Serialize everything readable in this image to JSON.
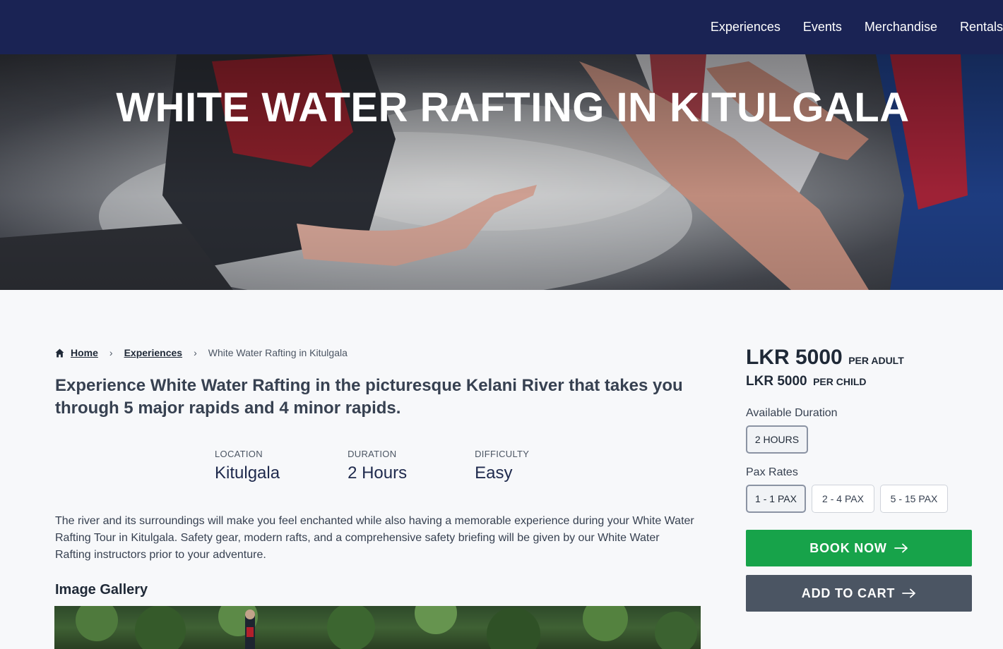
{
  "nav": {
    "items": [
      "Experiences",
      "Events",
      "Merchandise",
      "Rentals"
    ]
  },
  "hero": {
    "title": "WHITE WATER RAFTING IN KITULGALA"
  },
  "breadcrumb": {
    "home": "Home",
    "experiences": "Experiences",
    "current": "White Water Rafting in Kitulgala",
    "home_icon": "home-icon",
    "separator": "›"
  },
  "intro": {
    "lead": "Experience White Water Rafting in the picturesque Kelani River that takes you through 5 major rapids and 4 minor rapids.",
    "facts": [
      {
        "label": "LOCATION",
        "value": "Kitulgala"
      },
      {
        "label": "DURATION",
        "value": "2 Hours"
      },
      {
        "label": "DIFFICULTY",
        "value": "Easy"
      }
    ],
    "description": "The river and its surroundings will make you feel enchanted while also having a memorable experience during your White Water Rafting Tour in Kitulgala. Safety gear, modern rafts, and a comprehensive safety briefing will be given by our White Water Rafting instructors prior to your adventure."
  },
  "gallery": {
    "title": "Image Gallery"
  },
  "pricing": {
    "adult_price": "LKR 5000",
    "adult_unit": "PER ADULT",
    "child_price": "LKR 5000",
    "child_unit": "PER CHILD",
    "duration_label": "Available Duration",
    "duration_options": [
      "2 HOURS"
    ],
    "pax_label": "Pax Rates",
    "pax_options": [
      "1 - 1 PAX",
      "2 - 4 PAX",
      "5 - 15 PAX"
    ],
    "selected_duration": "2 HOURS",
    "selected_pax": "1 - 1 PAX"
  },
  "actions": {
    "book": "BOOK NOW",
    "cart": "ADD TO CART"
  },
  "colors": {
    "nav_bg": "#1a2354",
    "book_bg": "#17a34a",
    "cart_bg": "#4b5563",
    "page_bg": "#f7f8fa"
  }
}
